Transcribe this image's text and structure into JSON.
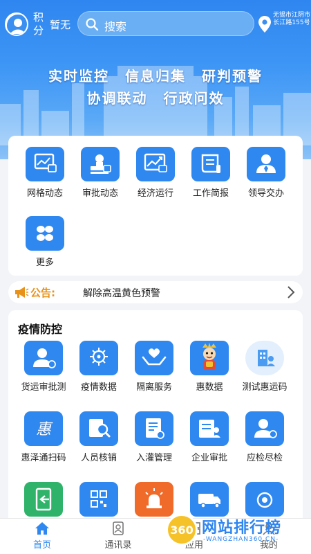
{
  "header": {
    "points_label": "积分",
    "points_value": "暂无",
    "search_placeholder": "搜索",
    "location": "无锡市江阴市长江路155号"
  },
  "banner": {
    "slogan_line1": "实时监控 信息归集 研判预警",
    "slogan_line2": "协调联动 行政问效"
  },
  "quick_menu": [
    {
      "label": "网格动态",
      "icon": "grid-monitor-icon"
    },
    {
      "label": "审批动态",
      "icon": "approval-stamp-icon"
    },
    {
      "label": "经济运行",
      "icon": "trend-chart-icon"
    },
    {
      "label": "工作简报",
      "icon": "scroll-report-icon"
    },
    {
      "label": "领导交办",
      "icon": "leader-person-icon"
    },
    {
      "label": "更多",
      "icon": "more-grid-icon"
    }
  ],
  "notice": {
    "label": "公告:",
    "text": "解除高温黄色预警"
  },
  "epidemic": {
    "title": "疫情防控",
    "items": [
      {
        "label": "货运审批测",
        "icon": "person-badge-icon"
      },
      {
        "label": "疫情数据",
        "icon": "virus-icon"
      },
      {
        "label": "隔离服务",
        "icon": "hands-heart-icon"
      },
      {
        "label": "惠数据",
        "icon": "mascot-icon"
      },
      {
        "label": "测试惠运码",
        "icon": "building-person-icon"
      },
      {
        "label": "惠泽通扫码",
        "icon": "hui-character-icon"
      },
      {
        "label": "人员核销",
        "icon": "search-frame-icon"
      },
      {
        "label": "入灌管理",
        "icon": "document-icon"
      },
      {
        "label": "企业审批",
        "icon": "id-card-icon"
      },
      {
        "label": "应检尽检",
        "icon": "person-check-icon"
      },
      {
        "label": "",
        "icon": "exit-door-icon"
      },
      {
        "label": "",
        "icon": "qr-code-icon"
      },
      {
        "label": "",
        "icon": "alarm-light-icon"
      },
      {
        "label": "",
        "icon": "truck-check-icon"
      },
      {
        "label": "",
        "icon": "signal-pin-icon"
      }
    ]
  },
  "tabs": [
    {
      "label": "首页",
      "active": true
    },
    {
      "label": "通讯录",
      "active": false
    },
    {
      "label": "应用",
      "active": false
    },
    {
      "label": "我的",
      "active": false
    }
  ],
  "watermark": {
    "logo_text": "360",
    "title": "网站排行榜",
    "subtitle": "-WANGZHAN360.CN-"
  },
  "colors": {
    "brand_blue": "#2f88f0",
    "notice_orange": "#e8921a",
    "alarm_orange": "#f06a2a",
    "exit_green": "#2fb36a"
  }
}
